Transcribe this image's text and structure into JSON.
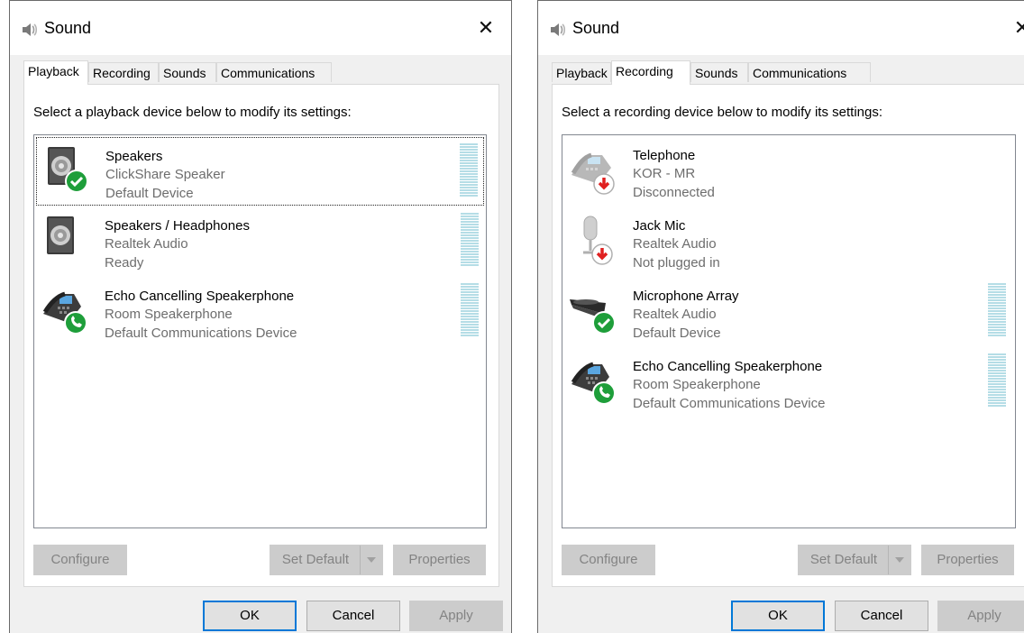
{
  "windows": [
    {
      "title": "Sound",
      "title_icon": "speaker-icon",
      "close_symbol": "✕",
      "tabs": [
        {
          "label": "Playback",
          "active": true
        },
        {
          "label": "Recording",
          "active": false
        },
        {
          "label": "Sounds",
          "active": false
        },
        {
          "label": "Communications",
          "active": false
        }
      ],
      "instruction": "Select a playback device below to modify its settings:",
      "devices": [
        {
          "name": "Speakers",
          "description": "ClickShare Speaker",
          "status": "Default Device",
          "icon": "speaker-icon",
          "badge": "check-badge-icon",
          "selected": true
        },
        {
          "name": "Speakers / Headphones",
          "description": "Realtek Audio",
          "status": "Ready",
          "icon": "speaker-icon",
          "badge": "",
          "selected": false
        },
        {
          "name": "Echo Cancelling Speakerphone",
          "description": "Room Speakerphone",
          "status": "Default Communications Device",
          "icon": "speakerphone-icon",
          "badge": "phone-badge-icon",
          "selected": false
        }
      ],
      "buttons": {
        "configure": "Configure",
        "set_default": "Set Default",
        "properties": "Properties",
        "ok": "OK",
        "cancel": "Cancel",
        "apply": "Apply"
      }
    },
    {
      "title": "Sound",
      "title_icon": "speaker-icon",
      "close_symbol": "✕",
      "tabs": [
        {
          "label": "Playback",
          "active": false
        },
        {
          "label": "Recording",
          "active": true
        },
        {
          "label": "Sounds",
          "active": false
        },
        {
          "label": "Communications",
          "active": false
        }
      ],
      "instruction": "Select a recording device below to modify its settings:",
      "devices": [
        {
          "name": "Telephone",
          "description": "KOR - MR",
          "status": "Disconnected",
          "icon": "telephone-icon",
          "badge": "down-arrow-badge-icon",
          "selected": false
        },
        {
          "name": "Jack Mic",
          "description": "Realtek Audio",
          "status": "Not plugged in",
          "icon": "microphone-icon",
          "badge": "down-arrow-badge-icon",
          "selected": false
        },
        {
          "name": "Microphone Array",
          "description": "Realtek Audio",
          "status": "Default Device",
          "icon": "microphone-array-icon",
          "badge": "check-badge-icon",
          "selected": false
        },
        {
          "name": "Echo Cancelling Speakerphone",
          "description": "Room Speakerphone",
          "status": "Default Communications Device",
          "icon": "speakerphone-icon",
          "badge": "phone-badge-icon",
          "selected": false
        }
      ],
      "buttons": {
        "configure": "Configure",
        "set_default": "Set Default",
        "properties": "Properties",
        "ok": "OK",
        "cancel": "Cancel",
        "apply": "Apply"
      }
    }
  ],
  "colors": {
    "accent": "#0078d7",
    "meter": "#b5dde6",
    "check_badge": "#1e9e3a",
    "arrow_badge": "#e02020",
    "disabled_text": "#838383"
  }
}
